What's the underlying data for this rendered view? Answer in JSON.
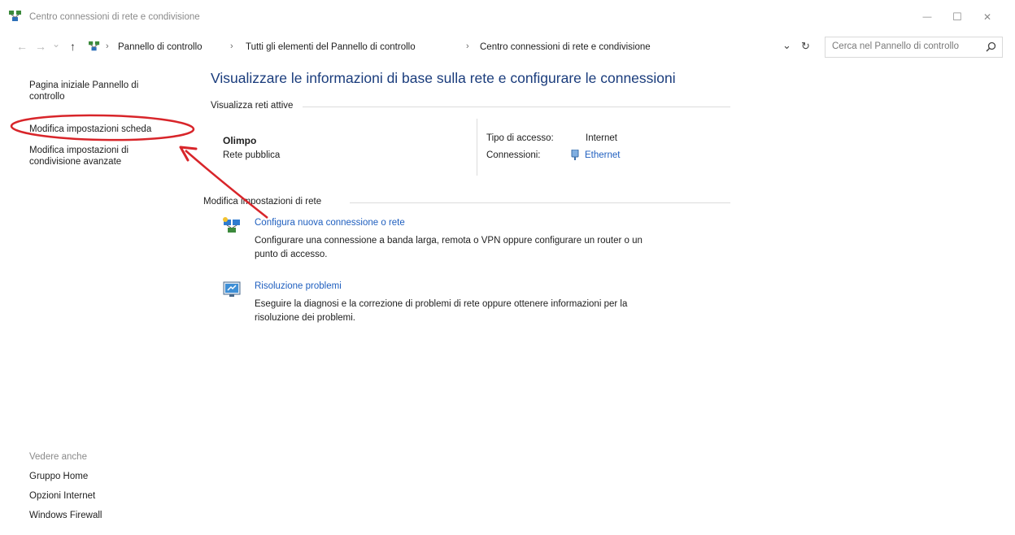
{
  "window": {
    "title": "Centro connessioni di rete e condivisione",
    "minimize_glyph": "—",
    "maximize_glyph": "☐",
    "close_glyph": "✕"
  },
  "nav": {
    "back": "←",
    "forward": "→",
    "recent": "⌄",
    "up": "↑",
    "breadcrumb": [
      "Pannello di controllo",
      "Tutti gli elementi del Pannello di controllo",
      "Centro connessioni di rete e condivisione"
    ],
    "separator": "›",
    "dropdown": "⌄",
    "refresh": "↻",
    "search_placeholder": "Cerca nel Pannello di controllo"
  },
  "sidebar": {
    "home_line1": "Pagina iniziale Pannello di",
    "home_line2": "controllo",
    "item_adapter": "Modifica impostazioni scheda",
    "item_sharing_line1": "Modifica impostazioni di",
    "item_sharing_line2": "condivisione avanzate",
    "see_also_label": "Vedere anche",
    "see_also": [
      "Gruppo Home",
      "Opzioni Internet",
      "Windows Firewall"
    ]
  },
  "main": {
    "heading": "Visualizzare le informazioni di base sulla rete e configurare le connessioni",
    "active_networks_label": "Visualizza reti attive",
    "network": {
      "name": "Olimpo",
      "type": "Rete pubblica",
      "access_type_label": "Tipo di accesso:",
      "access_type_value": "Internet",
      "connections_label": "Connessioni:",
      "connections_value": "Ethernet"
    },
    "change_settings_label": "Modifica impostazioni di rete",
    "tasks": [
      {
        "title": "Configura nuova connessione o rete",
        "desc_line1": "Configurare una connessione a banda larga, remota o VPN oppure configurare un router o un",
        "desc_line2": "punto di accesso."
      },
      {
        "title": "Risoluzione problemi",
        "desc_line1": "Eseguire la diagnosi e la correzione di problemi di rete oppure ottenere informazioni per la",
        "desc_line2": "risoluzione dei problemi."
      }
    ]
  },
  "colors": {
    "annotation_red": "#d8252a",
    "link_blue": "#1f5fbf",
    "heading_blue": "#1a3c7c"
  }
}
